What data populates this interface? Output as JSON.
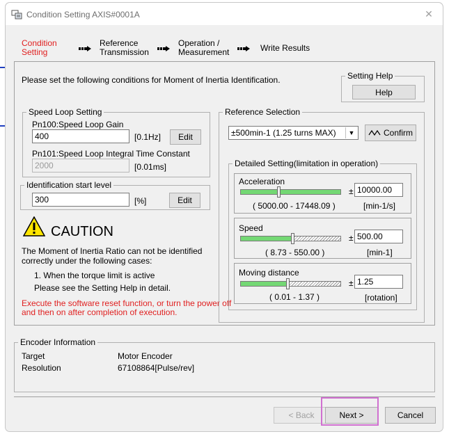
{
  "window": {
    "title": "Condition Setting AXIS#0001A"
  },
  "steps": [
    {
      "line1": "Condition",
      "line2": "Setting"
    },
    {
      "line1": "Reference",
      "line2": "Transmission"
    },
    {
      "line1": "Operation /",
      "line2": "Measurement"
    },
    {
      "line1": "Write Results",
      "line2": ""
    }
  ],
  "intro": "Please set the following conditions for Moment of Inertia Identification.",
  "setting_help": {
    "label": "Setting Help",
    "button": "Help"
  },
  "speed_loop": {
    "label": "Speed Loop Setting",
    "gain_label": "Pn100:Speed Loop Gain",
    "gain_value": "400",
    "gain_unit": "[0.1Hz]",
    "edit": "Edit",
    "integral_label": "Pn101:Speed Loop Integral Time Constant",
    "integral_value": "2000",
    "integral_unit": "[0.01ms]"
  },
  "identification": {
    "label": "Identification start level",
    "value": "300",
    "unit": "[%]",
    "edit": "Edit"
  },
  "caution": {
    "title": "CAUTION",
    "line1": "The Moment of Inertia Ratio can not be identified",
    "line2": "correctly under the following cases:",
    "case1": "1. When the torque limit is active",
    "help_note": "Please see the Setting Help in detail.",
    "red1": "Execute the software reset function, or turn the power off",
    "red2": "and then on after completion of execution."
  },
  "reference": {
    "label": "Reference Selection",
    "selected": "±500min-1 (1.25 turns MAX)",
    "confirm": "Confirm"
  },
  "detailed": {
    "label": "Detailed Setting(limitation in operation)",
    "acceleration": {
      "label": "Acceleration",
      "pm": "±",
      "value": "10000.00",
      "range": "( 5000.00 - 17448.09 )",
      "unit": "[min-1/s]",
      "level": 0.38
    },
    "speed": {
      "label": "Speed",
      "pm": "±",
      "value": "500.00",
      "range": "( 8.73 - 550.00 )",
      "unit": "[min-1]",
      "level": 0.52
    },
    "distance": {
      "label": "Moving distance",
      "pm": "±",
      "value": "1.25",
      "range": "( 0.01 - 1.37 )",
      "unit": "[rotation]",
      "level": 0.47
    }
  },
  "encoder": {
    "label": "Encoder Information",
    "target_label": "Target",
    "target_value": "Motor Encoder",
    "resolution_label": "Resolution",
    "resolution_value": "67108864[Pulse/rev]"
  },
  "footer": {
    "back": "< Back",
    "next": "Next >",
    "cancel": "Cancel"
  }
}
